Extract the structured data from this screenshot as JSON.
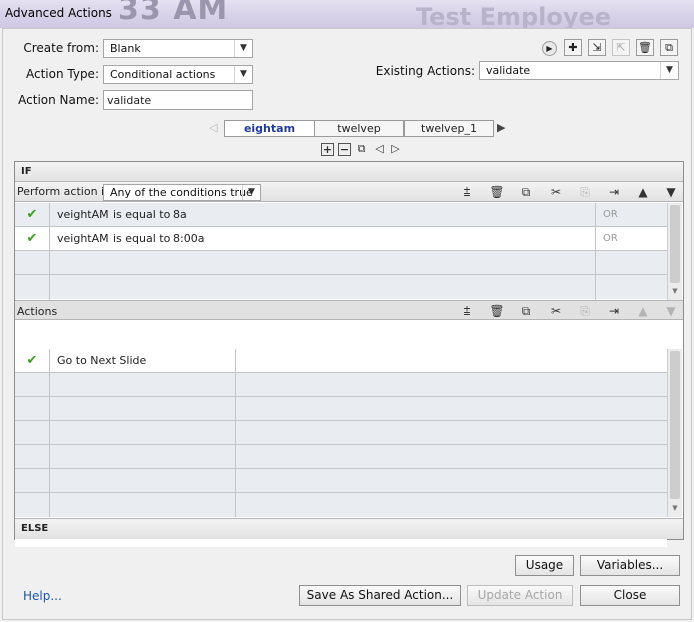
{
  "window": {
    "title": "Advanced Actions",
    "background_text_left": "33 AM",
    "background_text_center": "Test Employee"
  },
  "form": {
    "create_from_label": "Create from:",
    "create_from_value": "Blank",
    "action_type_label": "Action Type:",
    "action_type_value": "Conditional actions",
    "action_name_label": "Action Name:",
    "action_name_value": "validate",
    "existing_actions_label": "Existing Actions:",
    "existing_actions_value": "validate"
  },
  "tabs": [
    {
      "label": "eightam",
      "active": true
    },
    {
      "label": "twelvep",
      "active": false
    },
    {
      "label": "twelvep_1",
      "active": false
    }
  ],
  "condition_section": {
    "if_label": "IF",
    "perform_label": "Perform action if:",
    "perform_value": "Any of the conditions true",
    "rows": [
      {
        "variable": "veightAM",
        "operator": "is equal to",
        "value": "8a",
        "logic": "OR"
      },
      {
        "variable": "veightAM",
        "operator": "is equal to",
        "value": "8:00a",
        "logic": "OR"
      }
    ]
  },
  "actions_section": {
    "label": "Actions",
    "rows": [
      {
        "action": "Go to Next Slide"
      }
    ]
  },
  "else_label": "ELSE",
  "buttons": {
    "usage": "Usage",
    "variables": "Variables...",
    "save_shared": "Save As Shared Action...",
    "update": "Update Action",
    "close": "Close",
    "help": "Help..."
  },
  "colors": {
    "active_tab": "#1f3b9e",
    "check": "#3aa11a",
    "link": "#1a56b0"
  }
}
